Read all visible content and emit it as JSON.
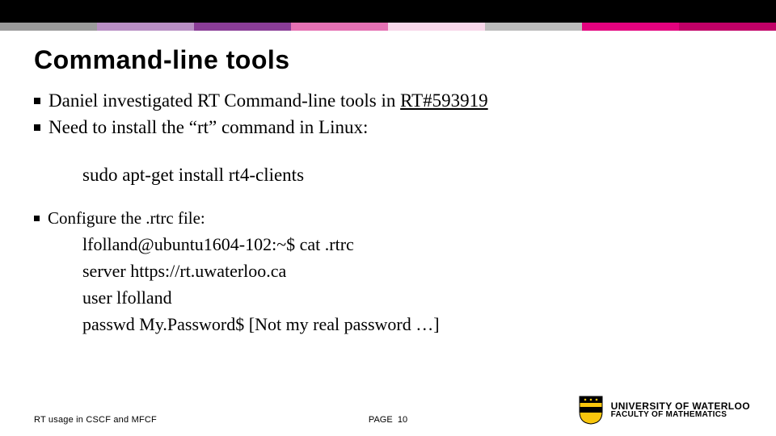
{
  "stripe_colors": [
    "#9b9b9b",
    "#b98fc4",
    "#8a3d97",
    "#e571b4",
    "#f8d7ea",
    "#bcbcbc",
    "#e3027e",
    "#c10067"
  ],
  "title": "Command-line tools",
  "bullets": {
    "b1_prefix": "Daniel investigated RT Command-line tools in ",
    "b1_link": "RT#593919",
    "b2": "Need to install the “rt” command in Linux:"
  },
  "command": "sudo apt-get install rt4-clients",
  "sub": {
    "title": "Configure the .rtrc file:",
    "l1": "lfolland@ubuntu1604-102:~$ cat .rtrc",
    "l2": "server https://rt.uwaterloo.ca",
    "l3": "user lfolland",
    "l4": "passwd My.Password$   [Not my real password …]"
  },
  "footer": {
    "left": "RT usage in CSCF and MFCF",
    "page_label": "PAGE",
    "page_num": "10",
    "uw1": "UNIVERSITY OF WATERLOO",
    "uw2": "FACULTY OF MATHEMATICS"
  }
}
